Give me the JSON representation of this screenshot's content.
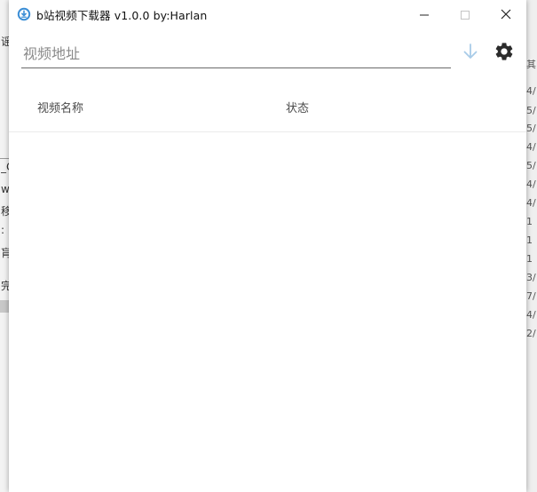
{
  "window": {
    "title": "b站视频下载器 v1.0.0 by:Harlan",
    "controls": {
      "minimize_icon": "minimize-icon",
      "maximize_icon": "maximize-icon",
      "close_icon": "close-icon"
    }
  },
  "toolbar": {
    "url_placeholder": "视频地址",
    "url_value": "",
    "download_icon": "arrow-down-icon",
    "settings_icon": "gear-icon"
  },
  "list": {
    "columns": [
      "视频名称",
      "状态"
    ],
    "rows": []
  },
  "background": {
    "left_fragments": [
      "谣",
      "_C",
      "w",
      "移",
      ":",
      "肓",
      "完"
    ],
    "right_fragments": [
      "其",
      "4/",
      "5/",
      "5/",
      "4/",
      "5/",
      "4/",
      "4/",
      "1",
      "1",
      "1",
      "3/",
      "7/",
      "4/",
      "2/"
    ]
  },
  "colors": {
    "accent_download": "#a8cbe8",
    "settings_gear": "#2b2b2b",
    "input_underline": "#6b6b6b",
    "app_icon": "#3d8fd6"
  }
}
